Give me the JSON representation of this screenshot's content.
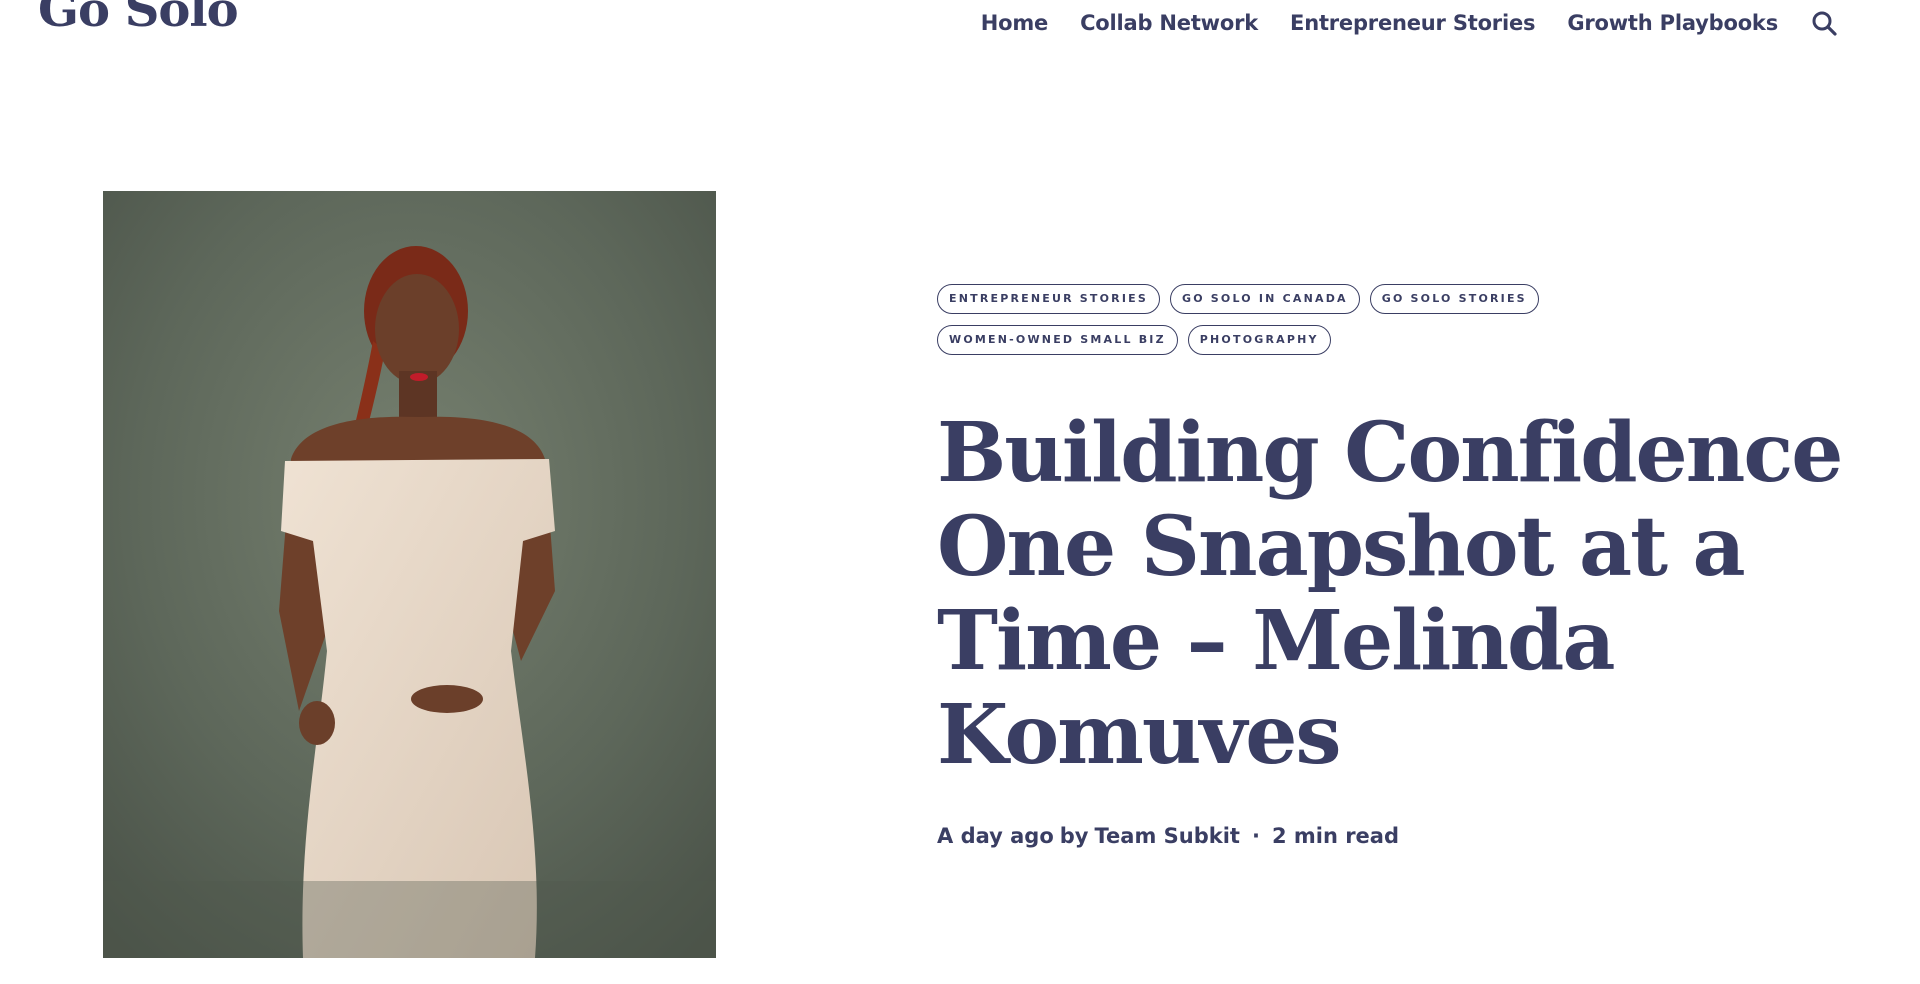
{
  "site": {
    "logo": "Go Solo"
  },
  "nav": {
    "items": [
      {
        "label": "Home"
      },
      {
        "label": "Collab Network"
      },
      {
        "label": "Entrepreneur Stories"
      },
      {
        "label": "Growth Playbooks"
      }
    ],
    "search_icon": "search-icon"
  },
  "post": {
    "tags": [
      "ENTREPRENEUR STORIES",
      "GO SOLO IN CANADA",
      "GO SOLO STORIES",
      "WOMEN-OWNED SMALL BIZ",
      "PHOTOGRAPHY"
    ],
    "title": "Building Confidence One Snapshot at a Time – Melinda Komuves",
    "time_ago": "A day ago",
    "by": "by",
    "author": "Team Subkit",
    "separator": "·",
    "read_time": "2 min read"
  },
  "colors": {
    "brand": "#3a3e63",
    "background": "#ffffff",
    "photo_backdrop": "#5f6a5e"
  }
}
